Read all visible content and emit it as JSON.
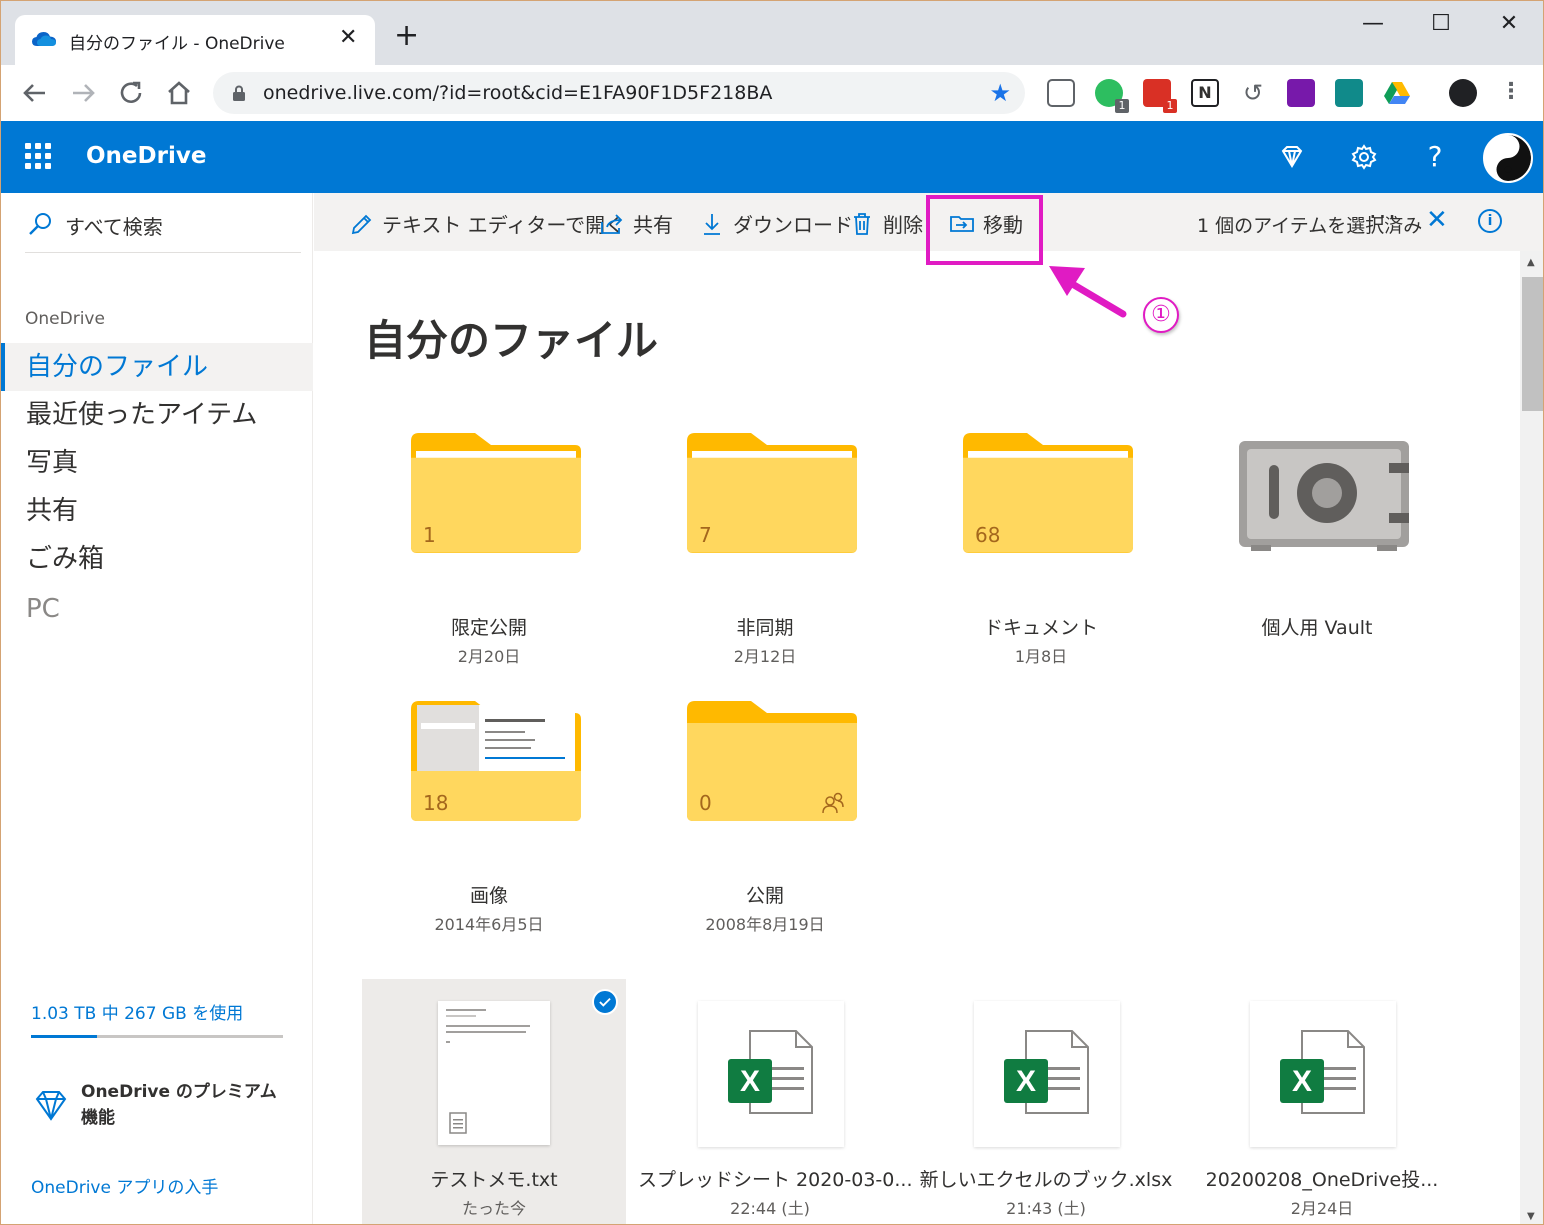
{
  "browser": {
    "tab_title": "自分のファイル - OneDrive",
    "tab_close": "✕",
    "new_tab": "+",
    "url": "onedrive.live.com/?id=root&cid=E1FA90F1D5F218BA",
    "window_controls": {
      "minimize": "—",
      "maximize": "☐",
      "close": "✕"
    },
    "extensions": [
      {
        "name": "pocket-icon"
      },
      {
        "name": "evernote-icon",
        "badge": "1"
      },
      {
        "name": "gmail-checker-icon",
        "badge": "1"
      },
      {
        "name": "notion-icon"
      },
      {
        "name": "history-icon"
      },
      {
        "name": "onenote-icon"
      },
      {
        "name": "sway-icon"
      },
      {
        "name": "google-drive-icon"
      },
      {
        "name": "profile-icon"
      },
      {
        "name": "menu-icon"
      }
    ]
  },
  "app": {
    "brand": "OneDrive",
    "accent": "#0078d4"
  },
  "sidebar": {
    "search_label": "すべて検索",
    "section": "OneDrive",
    "items": [
      {
        "label": "自分のファイル",
        "active": true
      },
      {
        "label": "最近使ったアイテム"
      },
      {
        "label": "写真"
      },
      {
        "label": "共有"
      },
      {
        "label": "ごみ箱"
      },
      {
        "label": "PC",
        "muted": true
      }
    ],
    "quota_text": "1.03 TB 中 267 GB を使用",
    "quota_fraction": 0.26,
    "premium_text": "OneDrive のプレミアム機能",
    "app_link": "OneDrive アプリの入手"
  },
  "commandbar": {
    "open_editor": "テキスト エディターで開く",
    "share": "共有",
    "download": "ダウンロード",
    "delete": "削除",
    "move": "移動",
    "more": "···",
    "selected_count": "1 個のアイテムを選択済み",
    "clear_selection": "✕",
    "info": "i"
  },
  "annotation": {
    "step": "①",
    "color": "#e01bc3"
  },
  "main": {
    "title": "自分のファイル",
    "folders": [
      {
        "name": "限定公開",
        "date": "2月20日",
        "count": "1"
      },
      {
        "name": "非同期",
        "date": "2月12日",
        "count": "7"
      },
      {
        "name": "ドキュメント",
        "date": "1月8日",
        "count": "68"
      },
      {
        "name": "個人用 Vault",
        "date": ""
      },
      {
        "name": "画像",
        "date": "2014年6月5日",
        "count": "18"
      },
      {
        "name": "公開",
        "date": "2008年8月19日",
        "count": "0"
      }
    ],
    "files": [
      {
        "name": "テストメモ.txt",
        "date": "たった今",
        "selected": true
      },
      {
        "name": "スプレッドシート 2020-03-0...",
        "date": "22:44 (土)"
      },
      {
        "name": "新しいエクセルのブック.xlsx",
        "date": "21:43 (土)"
      },
      {
        "name": "20200208_OneDrive投...",
        "date": "2月24日"
      }
    ]
  }
}
